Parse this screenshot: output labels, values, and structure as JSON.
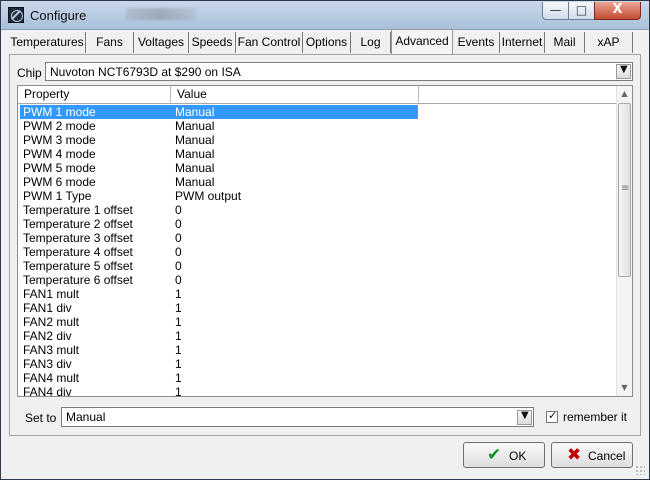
{
  "window": {
    "title": "Configure",
    "controls": {
      "minimize": "—",
      "maximize": "□",
      "close": "X"
    }
  },
  "tabs": [
    {
      "label": "Temperatures"
    },
    {
      "label": "Fans"
    },
    {
      "label": "Voltages"
    },
    {
      "label": "Speeds"
    },
    {
      "label": "Fan Control"
    },
    {
      "label": "Options"
    },
    {
      "label": "Log"
    },
    {
      "label": "Advanced",
      "active": true
    },
    {
      "label": "Events"
    },
    {
      "label": "Internet"
    },
    {
      "label": "Mail"
    },
    {
      "label": "xAP"
    }
  ],
  "chip": {
    "label": "Chip",
    "value": "Nuvoton NCT6793D at $290 on ISA"
  },
  "table": {
    "headers": {
      "property": "Property",
      "value": "Value"
    },
    "selected_row": 0,
    "rows": [
      {
        "property": "PWM 1 mode",
        "value": "Manual"
      },
      {
        "property": "PWM 2 mode",
        "value": "Manual"
      },
      {
        "property": "PWM 3 mode",
        "value": "Manual"
      },
      {
        "property": "PWM 4 mode",
        "value": "Manual"
      },
      {
        "property": "PWM 5 mode",
        "value": "Manual"
      },
      {
        "property": "PWM 6 mode",
        "value": "Manual"
      },
      {
        "property": "PWM 1 Type",
        "value": "PWM output"
      },
      {
        "property": "Temperature 1 offset",
        "value": "0"
      },
      {
        "property": "Temperature 2 offset",
        "value": "0"
      },
      {
        "property": "Temperature 3 offset",
        "value": "0"
      },
      {
        "property": "Temperature 4 offset",
        "value": "0"
      },
      {
        "property": "Temperature 5 offset",
        "value": "0"
      },
      {
        "property": "Temperature 6 offset",
        "value": "0"
      },
      {
        "property": "FAN1 mult",
        "value": "1"
      },
      {
        "property": "FAN1 div",
        "value": "1"
      },
      {
        "property": "FAN2 mult",
        "value": "1"
      },
      {
        "property": "FAN2 div",
        "value": "1"
      },
      {
        "property": "FAN3 mult",
        "value": "1"
      },
      {
        "property": "FAN3 div",
        "value": "1"
      },
      {
        "property": "FAN4 mult",
        "value": "1"
      },
      {
        "property": "FAN4 div",
        "value": "1"
      }
    ]
  },
  "set_to": {
    "label": "Set to",
    "value": "Manual",
    "remember_label": "remember it",
    "remember_checked": true
  },
  "buttons": {
    "ok": "OK",
    "cancel": "Cancel"
  },
  "icons": {
    "dropdown": "chevron-down-icon",
    "ok": "checkmark-icon",
    "cancel": "cancel-x-icon"
  },
  "colors": {
    "selection": "#3399ff",
    "ok_icon": "#0a8f21",
    "cancel_icon": "#c20000"
  }
}
